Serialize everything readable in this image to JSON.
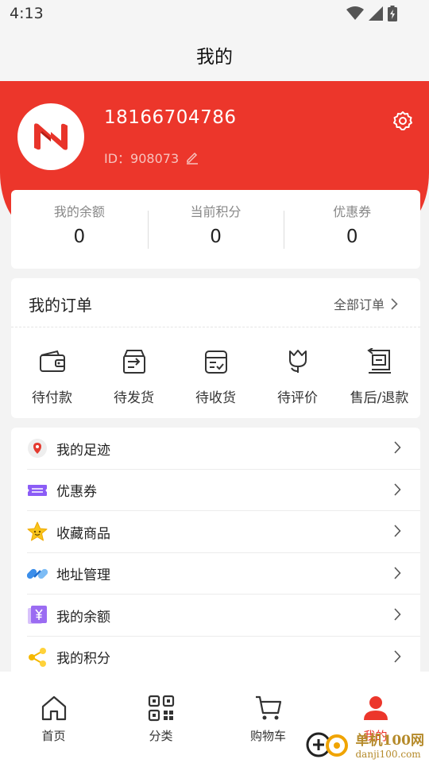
{
  "status": {
    "time": "4:13"
  },
  "page": {
    "title": "我的"
  },
  "user": {
    "phone": "18166704786",
    "id_text": "ID：908073"
  },
  "stats": [
    {
      "label": "我的余额",
      "value": "0"
    },
    {
      "label": "当前积分",
      "value": "0"
    },
    {
      "label": "优惠券",
      "value": "0"
    }
  ],
  "orders": {
    "title": "我的订单",
    "all_label": "全部订单",
    "items": [
      {
        "label": "待付款",
        "icon": "wallet-icon"
      },
      {
        "label": "待发货",
        "icon": "shipping-box-icon"
      },
      {
        "label": "待收货",
        "icon": "receive-box-icon"
      },
      {
        "label": "待评价",
        "icon": "tulip-icon"
      },
      {
        "label": "售后/退款",
        "icon": "refund-icon"
      }
    ]
  },
  "menu": [
    {
      "label": "我的足迹",
      "icon": "footprint-icon"
    },
    {
      "label": "优惠券",
      "icon": "coupon-icon"
    },
    {
      "label": "收藏商品",
      "icon": "star-icon"
    },
    {
      "label": "地址管理",
      "icon": "link-icon"
    },
    {
      "label": "我的余额",
      "icon": "yuan-icon"
    },
    {
      "label": "我的积分",
      "icon": "share-icon"
    }
  ],
  "tabs": [
    {
      "label": "首页",
      "icon": "home-icon"
    },
    {
      "label": "分类",
      "icon": "qr-icon"
    },
    {
      "label": "购物车",
      "icon": "cart-icon"
    },
    {
      "label": "我的",
      "icon": "user-icon",
      "active": true
    }
  ],
  "watermark": {
    "main": "单机100网",
    "sub": "danji100.com"
  },
  "colors": {
    "brand": "#ec362b",
    "header_subtext": "#f7c3be"
  }
}
